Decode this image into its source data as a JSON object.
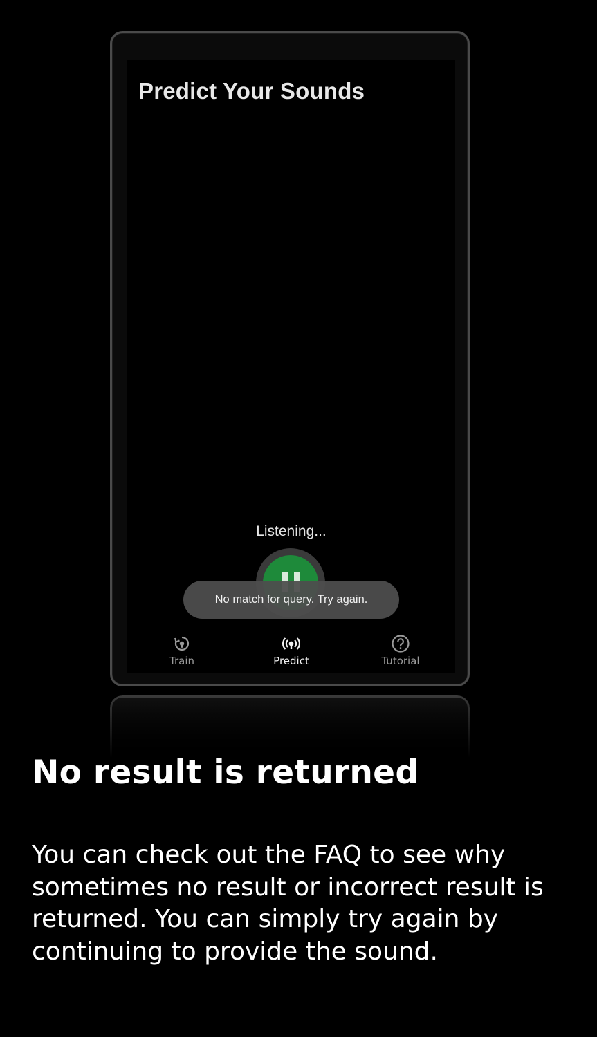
{
  "app": {
    "title": "Predict Your Sounds",
    "status_text": "Listening...",
    "toast_message": "No match for query. Try again.",
    "record_button": {
      "state": "listening",
      "icon": "pause-icon",
      "color": "#1e8a3a"
    }
  },
  "bottom_nav": {
    "active": "predict",
    "items": [
      {
        "id": "train",
        "label": "Train",
        "icon": "train-icon"
      },
      {
        "id": "predict",
        "label": "Predict",
        "icon": "broadcast-icon"
      },
      {
        "id": "tutorial",
        "label": "Tutorial",
        "icon": "help-circle-icon"
      }
    ]
  },
  "caption": {
    "headline": "No result is returned",
    "description": "You can check out the FAQ to see why sometimes no result or incorrect result is returned. You can simply try again by continuing to provide the sound."
  },
  "colors": {
    "background": "#000000",
    "accent_green": "#1e8a3a",
    "toast_bg": "#4e4e4e"
  }
}
